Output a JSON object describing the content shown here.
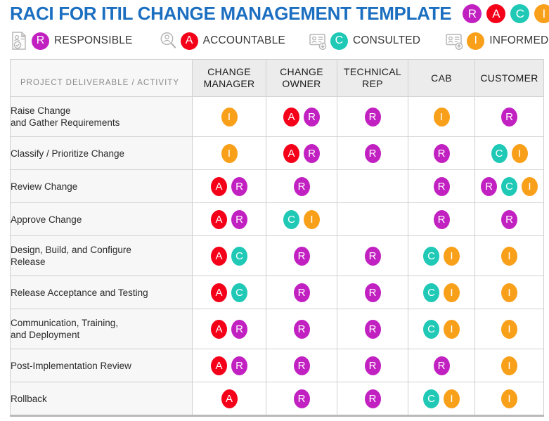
{
  "title": {
    "text": "RACI FOR ITIL CHANGE MANAGEMENT TEMPLATE",
    "color": "#1c6fc0",
    "badges": [
      {
        "letter": "R",
        "color": "#c221c2",
        "name": "responsible"
      },
      {
        "letter": "A",
        "color": "#f40019",
        "name": "accountable"
      },
      {
        "letter": "C",
        "color": "#1fc9b6",
        "name": "consulted"
      },
      {
        "letter": "I",
        "color": "#f9a01b",
        "name": "informed"
      }
    ]
  },
  "legend": [
    {
      "key": "R",
      "label": "RESPONSIBLE",
      "color": "#c221c2",
      "icon": "document-person-check-icon"
    },
    {
      "key": "A",
      "label": "ACCOUNTABLE",
      "color": "#f40019",
      "icon": "magnifier-person-icon"
    },
    {
      "key": "C",
      "label": "CONSULTED",
      "color": "#1fc9b6",
      "icon": "id-card-download-icon"
    },
    {
      "key": "I",
      "label": "INFORMED",
      "color": "#f9a01b",
      "icon": "id-card-upload-icon"
    }
  ],
  "colors": {
    "responsible": "#c221c2",
    "accountable": "#f40019",
    "consulted": "#1fc9b6",
    "informed": "#f9a01b",
    "header_bg": "#ececec",
    "activity_bg": "#f7f7f7",
    "border": "#d0d0d0",
    "accent_border": "#b9b9b9"
  },
  "table": {
    "deliverable_header": "PROJECT DELIVERABLE / ACTIVITY",
    "role_headers": [
      "CHANGE MANAGER",
      "CHANGE OWNER",
      "TECHNICAL REP",
      "CAB",
      "CUSTOMER"
    ],
    "rows": [
      {
        "activity": "Raise Change and Gather Requirements",
        "activity_lines": [
          "Raise Change",
          "and Gather Requirements"
        ],
        "cells": [
          [
            "I"
          ],
          [
            "A",
            "R"
          ],
          [
            "R"
          ],
          [
            "I"
          ],
          [
            "R"
          ]
        ]
      },
      {
        "activity": "Classify / Prioritize Change",
        "activity_lines": [
          "Classify / Prioritize Change"
        ],
        "cells": [
          [
            "I"
          ],
          [
            "A",
            "R"
          ],
          [
            "R"
          ],
          [
            "R"
          ],
          [
            "C",
            "I"
          ]
        ]
      },
      {
        "activity": "Review Change",
        "activity_lines": [
          "Review Change"
        ],
        "cells": [
          [
            "A",
            "R"
          ],
          [
            "R"
          ],
          [],
          [
            "R"
          ],
          [
            "R",
            "C",
            "I"
          ]
        ]
      },
      {
        "activity": "Approve Change",
        "activity_lines": [
          "Approve Change"
        ],
        "cells": [
          [
            "A",
            "R"
          ],
          [
            "C",
            "I"
          ],
          [],
          [
            "R"
          ],
          [
            "R"
          ]
        ]
      },
      {
        "activity": "Design, Build, and Configure Release",
        "activity_lines": [
          "Design, Build, and Configure",
          "Release"
        ],
        "cells": [
          [
            "A",
            "C"
          ],
          [
            "R"
          ],
          [
            "R"
          ],
          [
            "C",
            "I"
          ],
          [
            "I"
          ]
        ]
      },
      {
        "activity": "Release Acceptance and Testing",
        "activity_lines": [
          "Release Acceptance and Testing"
        ],
        "cells": [
          [
            "A",
            "C"
          ],
          [
            "R"
          ],
          [
            "R"
          ],
          [
            "C",
            "I"
          ],
          [
            "I"
          ]
        ]
      },
      {
        "activity": "Communication, Training, and Deployment",
        "activity_lines": [
          "Communication, Training,",
          "and Deployment"
        ],
        "cells": [
          [
            "A",
            "R"
          ],
          [
            "R"
          ],
          [
            "R"
          ],
          [
            "C",
            "I"
          ],
          [
            "I"
          ]
        ]
      },
      {
        "activity": "Post-Implementation Review",
        "activity_lines": [
          "Post-Implementation Review"
        ],
        "cells": [
          [
            "A",
            "R"
          ],
          [
            "R"
          ],
          [
            "R"
          ],
          [
            "R"
          ],
          [
            "I"
          ]
        ]
      },
      {
        "activity": "Rollback",
        "activity_lines": [
          "Rollback"
        ],
        "cells": [
          [
            "A"
          ],
          [
            "R"
          ],
          [
            "R"
          ],
          [
            "C",
            "I"
          ],
          [
            "I"
          ]
        ]
      }
    ]
  }
}
